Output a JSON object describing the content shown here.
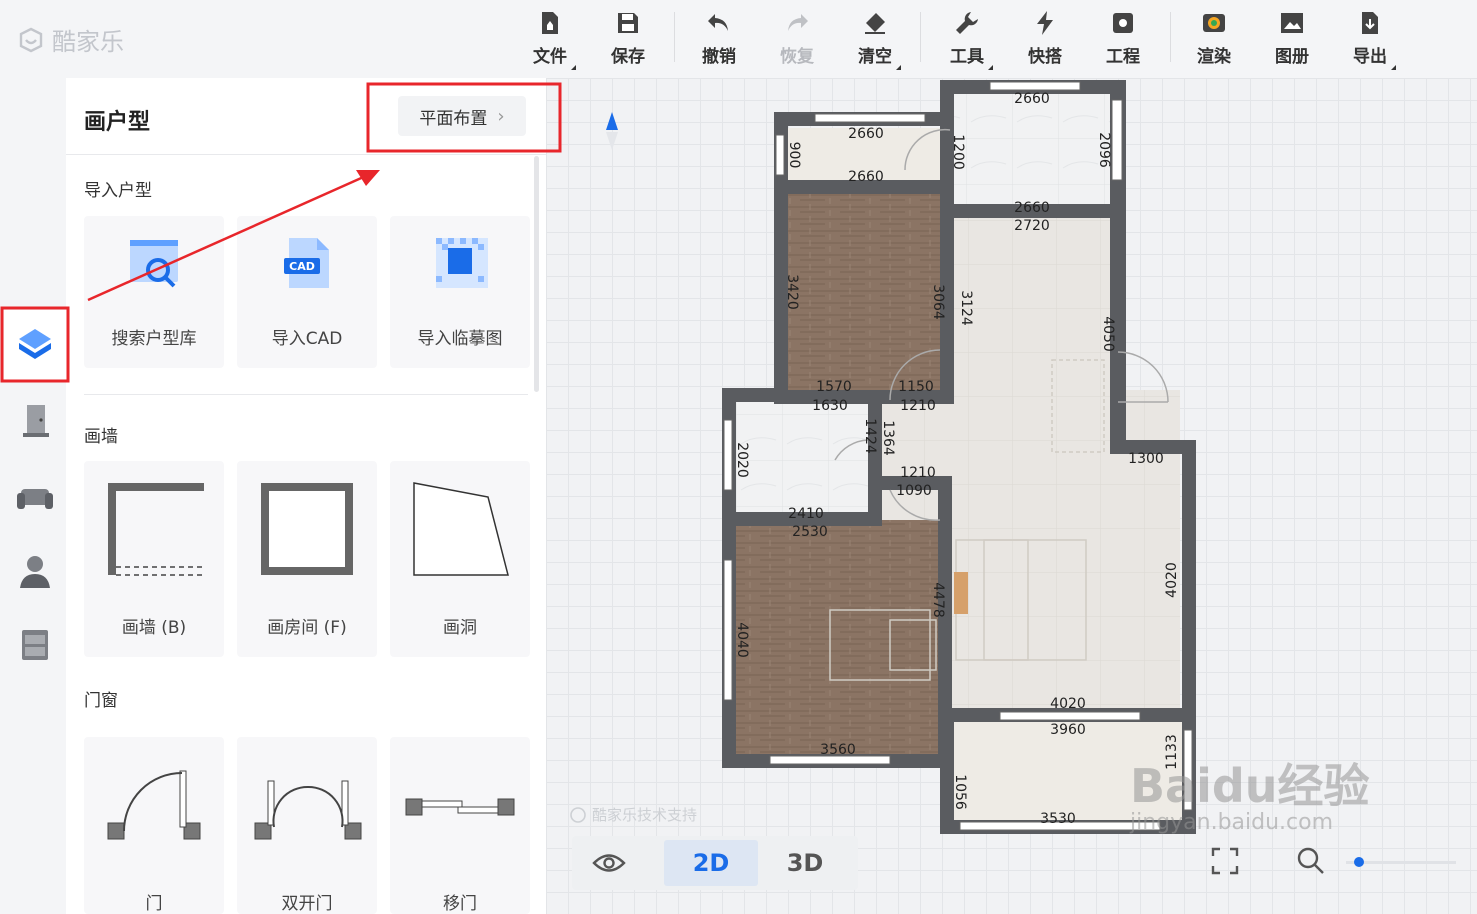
{
  "app": {
    "logo_text": "酷家乐"
  },
  "toolbar": {
    "file": "文件",
    "save": "保存",
    "undo": "撤销",
    "redo": "恢复",
    "clear": "清空",
    "tools": "工具",
    "quick": "快搭",
    "project": "工程",
    "render": "渲染",
    "album": "图册",
    "export": "导出"
  },
  "panel": {
    "title": "画户型",
    "layout_button": "平面布置",
    "import_section": "导入户型",
    "import_items": [
      "搜索户型库",
      "导入CAD",
      "导入临摹图"
    ],
    "cad_badge": "CAD",
    "wall_section": "画墙",
    "wall_items": [
      "画墙 (B)",
      "画房间 (F)",
      "画洞"
    ],
    "door_section": "门窗",
    "door_items": [
      "门",
      "双开门",
      "移门"
    ]
  },
  "view": {
    "mode_2d": "2D",
    "mode_3d": "3D"
  },
  "canvas": {
    "support_text": "酷家乐技术支持"
  },
  "floorplan": {
    "dimensions": [
      "2660",
      "2660",
      "2660",
      "2660",
      "2660",
      "2720",
      "900",
      "1200",
      "2096",
      "3420",
      "3064",
      "3124",
      "4050",
      "1570",
      "1150",
      "1630",
      "1210",
      "1424",
      "1364",
      "2020",
      "1210",
      "1090",
      "1300",
      "2410",
      "2530",
      "4020",
      "4040",
      "4478",
      "4020",
      "3960",
      "3560",
      "1133",
      "1056",
      "3530"
    ]
  },
  "watermark": {
    "brand": "Baidu经验",
    "url": "jingyan.baidu.com"
  },
  "colors": {
    "accent": "#1a6ce8",
    "highlight": "#e8262b",
    "wall": "#5a5c60",
    "wood": "#8a7463",
    "tile": "#e7e3de"
  }
}
